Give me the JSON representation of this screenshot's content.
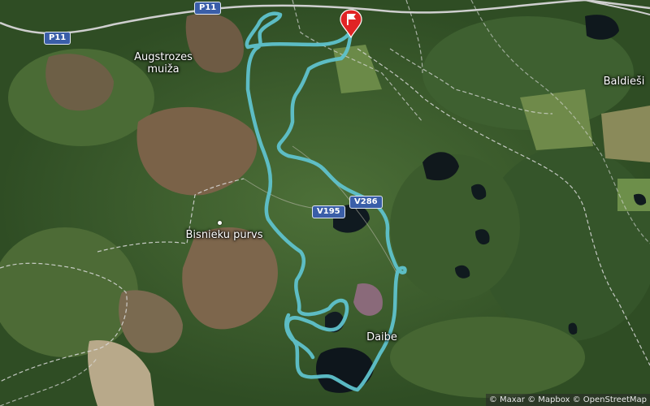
{
  "places": {
    "augstrozes": "Augstrozes",
    "muiza": "muiža",
    "baldiesi": "Baldieši",
    "bisnieku": "Bisnieku purvs",
    "daibe": "Daibe"
  },
  "roads": {
    "p11_top": "P11",
    "p11_left": "P11",
    "v286": "V286",
    "v195": "V195"
  },
  "attribution": "© Maxar © Mapbox © OpenStreetMap",
  "colors": {
    "route": "#5fc2cc",
    "pin": "#e02424",
    "shield": "#3a5ea8"
  },
  "icons": {
    "finish": "flag-pin-icon"
  }
}
